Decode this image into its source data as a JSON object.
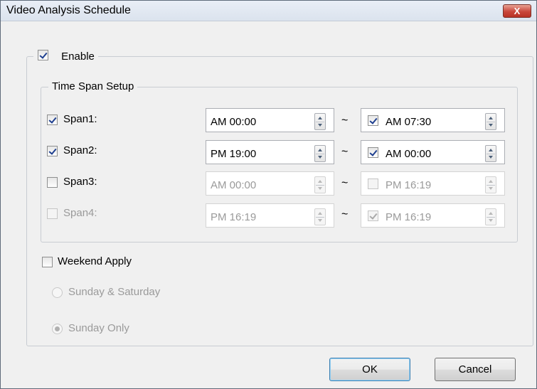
{
  "window": {
    "title": "Video Analysis Schedule",
    "close_label": "X"
  },
  "enable": {
    "label": "Enable",
    "checked": true
  },
  "time_span_setup": {
    "legend": "Time Span Setup",
    "separator": "~",
    "spans": [
      {
        "label": "Span1:",
        "checked": true,
        "start": "AM 00:00",
        "end": "AM 07:30",
        "end_checked": true,
        "enabled": true
      },
      {
        "label": "Span2:",
        "checked": true,
        "start": "PM 19:00",
        "end": "AM 00:00",
        "end_checked": true,
        "enabled": true
      },
      {
        "label": "Span3:",
        "checked": false,
        "start": "AM 00:00",
        "end": "PM 16:19",
        "end_checked": false,
        "enabled": true
      },
      {
        "label": "Span4:",
        "checked": false,
        "start": "PM 16:19",
        "end": "PM 16:19",
        "end_checked": true,
        "enabled": false
      }
    ]
  },
  "weekend": {
    "label": "Weekend Apply",
    "checked": false,
    "options": [
      {
        "label": "Sunday & Saturday",
        "selected": false
      },
      {
        "label": "Sunday Only",
        "selected": true
      }
    ]
  },
  "buttons": {
    "ok": "OK",
    "cancel": "Cancel"
  }
}
